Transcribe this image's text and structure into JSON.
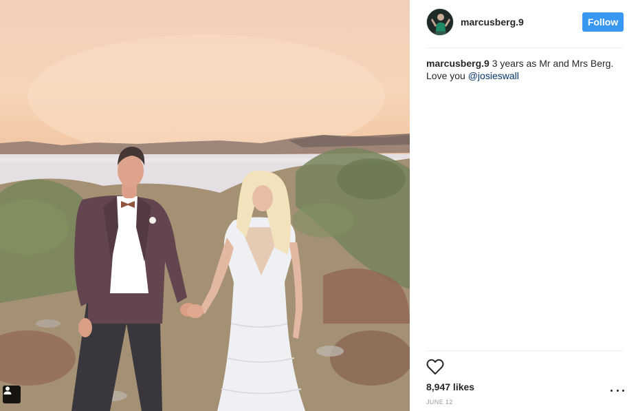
{
  "post": {
    "username": "marcusberg.9",
    "follow_label": "Follow",
    "caption_user": "marcusberg.9",
    "caption_text": " 3 years as Mr and Mrs Berg. Love you ",
    "caption_mention": "@josieswall",
    "likes": "8,947 likes",
    "date": "JUNE 12"
  },
  "icons": {
    "avatar": "avatar",
    "tag_user": "user-tag-icon",
    "like": "heart-icon",
    "more": "more-options-icon"
  },
  "colors": {
    "follow_button": "#3897f0",
    "mention": "#003569",
    "text": "#262626",
    "muted": "#999999"
  }
}
